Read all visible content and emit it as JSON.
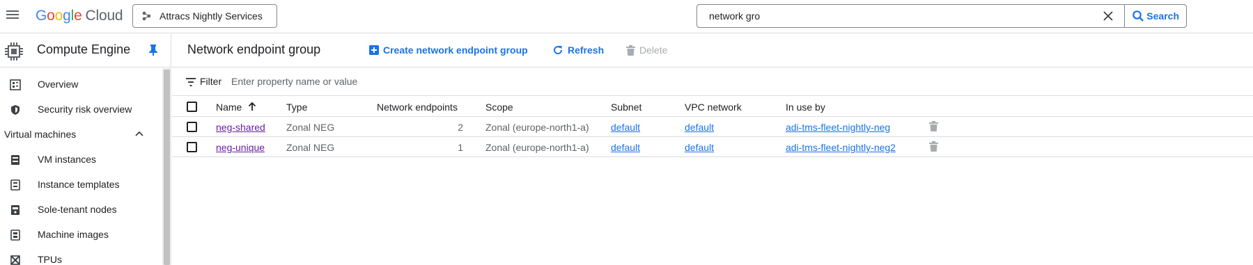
{
  "header": {
    "logo_text": "Google",
    "logo_suffix": "Cloud",
    "project_name": "Attracs Nightly Services",
    "search_value": "network gro",
    "search_button": "Search"
  },
  "sidebar": {
    "product_title": "Compute Engine",
    "items": [
      {
        "label": "Overview",
        "icon": "overview-icon"
      },
      {
        "label": "Security risk overview",
        "icon": "shield-icon"
      }
    ],
    "section": {
      "label": "Virtual machines",
      "expanded": true
    },
    "vm_items": [
      {
        "label": "VM instances",
        "icon": "vm-icon"
      },
      {
        "label": "Instance templates",
        "icon": "template-icon"
      },
      {
        "label": "Sole-tenant nodes",
        "icon": "node-icon"
      },
      {
        "label": "Machine images",
        "icon": "image-icon"
      },
      {
        "label": "TPUs",
        "icon": "tpu-icon"
      }
    ]
  },
  "page": {
    "title": "Network endpoint group",
    "actions": {
      "create": "Create network endpoint group",
      "refresh": "Refresh",
      "delete": "Delete"
    }
  },
  "filter": {
    "label": "Filter",
    "placeholder": "Enter property name or value"
  },
  "table": {
    "columns": [
      "Name",
      "Type",
      "Network endpoints",
      "Scope",
      "Subnet",
      "VPC network",
      "In use by"
    ],
    "rows": [
      {
        "name": "neg-shared",
        "type": "Zonal NEG",
        "endpoints": "2",
        "scope": "Zonal (europe-north1-a)",
        "subnet": "default",
        "vpc": "default",
        "in_use_by": "adi-tms-fleet-nightly-neg"
      },
      {
        "name": "neg-unique",
        "type": "Zonal NEG",
        "endpoints": "1",
        "scope": "Zonal (europe-north1-a)",
        "subnet": "default",
        "vpc": "default",
        "in_use_by": "adi-tms-fleet-nightly-neg2"
      }
    ]
  },
  "colors": {
    "accent": "#1a73e8",
    "visited_link": "#681da8",
    "border": "#dadce0",
    "disabled": "#a8abb0"
  }
}
